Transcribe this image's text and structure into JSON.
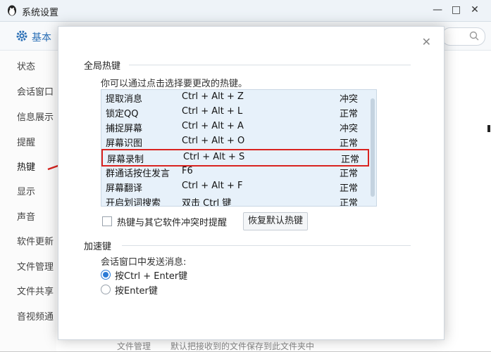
{
  "window": {
    "title": "系统设置",
    "controls": [
      "—",
      "□",
      "✕"
    ],
    "tab_label": "基本"
  },
  "sidebar": {
    "items": [
      {
        "label": "状态"
      },
      {
        "label": "会话窗口"
      },
      {
        "label": "信息展示"
      },
      {
        "label": "提醒"
      },
      {
        "label": "热键",
        "active": true
      },
      {
        "label": "显示"
      },
      {
        "label": "声音"
      },
      {
        "label": "软件更新"
      },
      {
        "label": "文件管理"
      },
      {
        "label": "文件共享"
      },
      {
        "label": "音视频通"
      }
    ]
  },
  "background_footer": {
    "label": "文件管理",
    "text": "默认把接收到的文件保存到此文件夹中"
  },
  "dialog": {
    "close_icon": "✕",
    "global_section_title": "全局热键",
    "hint": "你可以通过点击选择要更改的热键。",
    "hotkeys": [
      {
        "name": "提取消息",
        "key": "Ctrl + Alt + Z",
        "status": "冲突"
      },
      {
        "name": "锁定QQ",
        "key": "Ctrl + Alt + L",
        "status": "正常"
      },
      {
        "name": "捕捉屏幕",
        "key": "Ctrl + Alt + A",
        "status": "冲突"
      },
      {
        "name": "屏幕识图",
        "key": "Ctrl + Alt + O",
        "status": "正常"
      },
      {
        "name": "屏幕录制",
        "key": "Ctrl + Alt + S",
        "status": "正常",
        "selected": true
      },
      {
        "name": "群通话按住发言",
        "key": "F6",
        "status": "正常"
      },
      {
        "name": "屏幕翻译",
        "key": "Ctrl + Alt + F",
        "status": "正常"
      },
      {
        "name": "开启划词搜索",
        "key": "双击 Ctrl 键",
        "status": "正常"
      }
    ],
    "conflict_checkbox_label": "热键与其它软件冲突时提醒",
    "conflict_checkbox_checked": false,
    "restore_button": "恢复默认热键",
    "accel_section_title": "加速键",
    "send_label": "会话窗口中发送消息:",
    "send_options": [
      {
        "label": "按Ctrl + Enter键",
        "checked": true
      },
      {
        "label": "按Enter键",
        "checked": false
      }
    ]
  },
  "colors": {
    "highlight_border": "#d9231f",
    "list_background": "#e7f1fa",
    "accent": "#2b7bd6"
  },
  "icons": {
    "app": "penguin-icon",
    "tab": "gear-icon",
    "search": "search-icon",
    "annotation": "red-arrow-icon"
  }
}
